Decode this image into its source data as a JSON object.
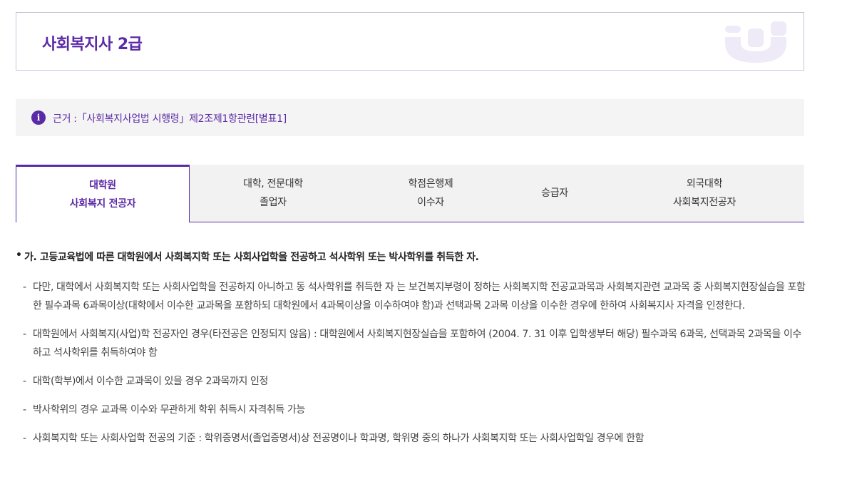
{
  "header": {
    "title": "사회복지사 2급"
  },
  "basis": {
    "text": "근거 :「사회복지사업법 시행령」제2조제1항관련[별표1]"
  },
  "tabs": [
    {
      "line1": "대학원",
      "line2": "사회복지 전공자"
    },
    {
      "line1": "대학, 전문대학",
      "line2": "졸업자"
    },
    {
      "line1": "학점은행제",
      "line2": "이수자"
    },
    {
      "line1": "승급자",
      "line2": ""
    },
    {
      "line1": "외국대학",
      "line2": "사회복지전공자"
    }
  ],
  "content": {
    "main": "가. 고등교육법에 따른 대학원에서 사회복지학 또는 사회사업학을 전공하고 석사학위 또는 박사학위를 취득한 자.",
    "subs": [
      "다만, 대학에서 사회복지학 또는 사회사업학을 전공하지 아니하고 동 석사학위를 취득한 자 는 보건복지부령이 정하는 사회복지학 전공교과목과 사회복지관련 교과목 중 사회복지현장실습을 포함한 필수과목 6과목이상(대학에서 이수한 교과목을 포함하되 대학원에서 4과목이상을 이수하여야 함)과 선택과목 2과목 이상을 이수한 경우에 한하여 사회복지사 자격을 인정한다.",
      "대학원에서 사회복지(사업)학 전공자인 경우(타전공은 인정되지 않음) : 대학원에서 사회복지현장실습을 포함하여 (2004. 7. 31 이후 입학생부터 해당) 필수과목 6과목, 선택과목 2과목을 이수하고 석사학위를 취득하여야 함",
      "대학(학부)에서 이수한 교과목이 있을 경우 2과목까지 인정",
      "박사학위의 경우 교과목 이수와 무관하게 학위 취득시 자격취득 가능",
      "사회복지학 또는 사회사업학 전공의 기준 : 학위증명서(졸업증명서)상 전공명이나 학과명, 학위명 중의 하나가 사회복지학 또는 사회사업학일 경우에 한함"
    ]
  },
  "colors": {
    "accent": "#5b2aa6",
    "panel": "#f4f4f4"
  },
  "icons": {
    "info": "info-icon",
    "logo": "brand-logo-icon"
  }
}
